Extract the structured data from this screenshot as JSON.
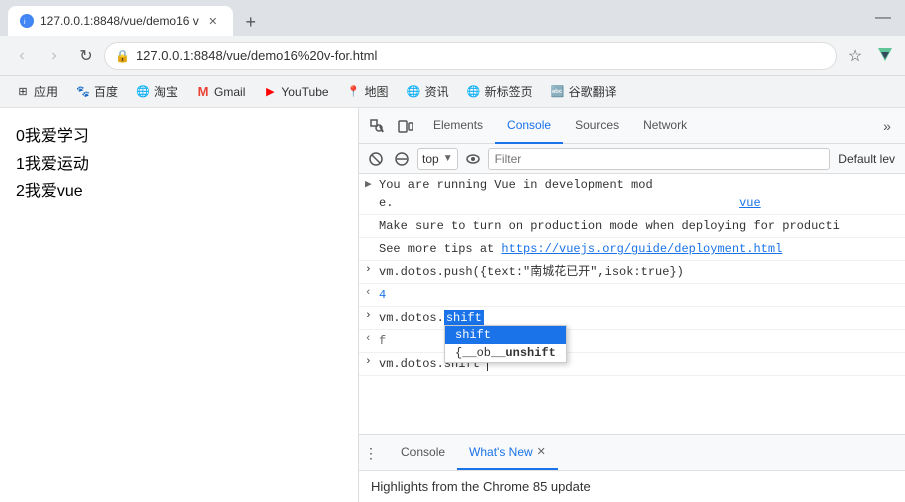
{
  "browser": {
    "title_bar": {
      "tab_title": "127.0.0.1:8848/vue/demo16 v",
      "new_tab_label": "+",
      "minimize_label": "—"
    },
    "nav": {
      "back_label": "‹",
      "forward_label": "›",
      "refresh_label": "↻",
      "address": "127.0.0.1:8848/vue/demo16%20v-for.html",
      "address_icon": "🔒",
      "bookmark_icon": "☆"
    },
    "bookmarks": [
      {
        "id": "apps",
        "icon": "⊞",
        "label": "应用"
      },
      {
        "id": "baidu",
        "icon": "🐾",
        "label": "百度"
      },
      {
        "id": "taobao",
        "icon": "🌐",
        "label": "淘宝"
      },
      {
        "id": "gmail",
        "icon": "M",
        "label": "Gmail"
      },
      {
        "id": "youtube",
        "icon": "▶",
        "label": "YouTube"
      },
      {
        "id": "maps",
        "icon": "📍",
        "label": "地图"
      },
      {
        "id": "news",
        "icon": "🌐",
        "label": "资讯"
      },
      {
        "id": "newtab",
        "icon": "🌐",
        "label": "新标签页"
      },
      {
        "id": "translate",
        "icon": "🔤",
        "label": "谷歌翻译"
      }
    ]
  },
  "page": {
    "items": [
      {
        "id": "item0",
        "text": "0我爱学习"
      },
      {
        "id": "item1",
        "text": "1我爱运动"
      },
      {
        "id": "item2",
        "text": "2我爱vue"
      }
    ]
  },
  "devtools": {
    "header_tabs": [
      "Elements",
      "Console",
      "Sources",
      "Network"
    ],
    "active_tab": "Console",
    "more_label": "»",
    "toolbar": {
      "context": "top",
      "filter_placeholder": "Filter",
      "default_level": "Default lev"
    },
    "console_lines": [
      {
        "id": "line-vue-msg1",
        "arrow": "",
        "indent": false,
        "text": "You are running Vue in development mode.",
        "link": "vue",
        "link_url": ""
      },
      {
        "id": "line-vue-msg2",
        "text": "Make sure to turn on production mode when deploying for producti",
        "link": "",
        "truncated": true
      },
      {
        "id": "line-vue-msg3",
        "text": "See more tips at ",
        "link": "https://vuejs.org/guide/deployment.html",
        "link_text": "https://vuejs.org/guide/deployment.html"
      },
      {
        "id": "line-push",
        "arrow": ">",
        "text": "vm.dotos.push({text:\"南城花已开\",isok:true})"
      },
      {
        "id": "line-result",
        "arrow": "<",
        "text": "4",
        "type": "number"
      },
      {
        "id": "line-shift-input",
        "arrow": ">",
        "text": "vm.dotos.",
        "autocomplete": true,
        "autocomplete_items": [
          {
            "label": "shift",
            "selected": true
          },
          {
            "label": "{__ob__unshift",
            "selected": false
          }
        ]
      },
      {
        "id": "line-f",
        "arrow": "<",
        "text": "f",
        "type": "result"
      },
      {
        "id": "line-shift-input2",
        "arrow": ">",
        "text": "vm.dotos.shift|",
        "cursor": true
      }
    ],
    "bottom_tabs": [
      {
        "id": "console-tab",
        "label": "Console",
        "closeable": false
      },
      {
        "id": "whats-new-tab",
        "label": "What's New",
        "closeable": true
      }
    ],
    "active_bottom_tab": "whats-new-tab",
    "whats_new": {
      "text": "Highlights from the Chrome 85 update"
    },
    "icons": {
      "inspect": "⬚",
      "device": "⬜",
      "clear": "🚫",
      "more_vert": "⋮"
    }
  }
}
